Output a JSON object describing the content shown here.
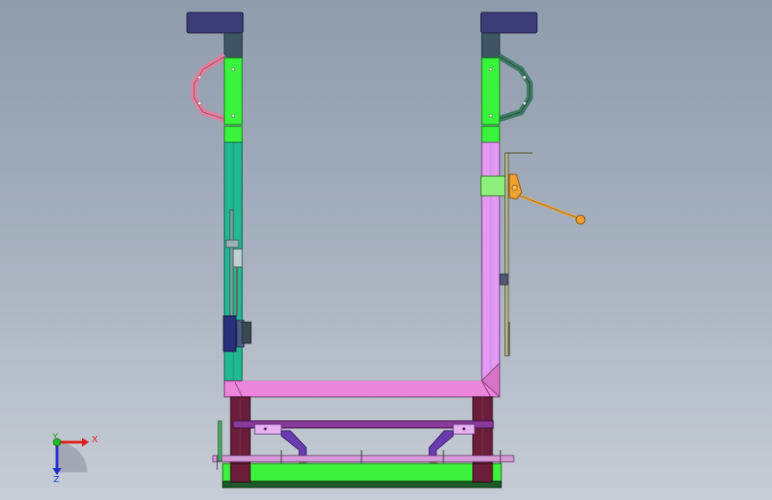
{
  "colors": {
    "background_top": "#8f9cac",
    "background_bottom": "#c7cdd6",
    "cap_navy": "#3b3d78",
    "column_slate": "#3e5566",
    "bracket_green": "#38f43a",
    "left_column_teal": "#22b892",
    "right_column_violet": "#e39af2",
    "base_pink": "#ec86dc",
    "left_handle_pink": "#e37f9f",
    "right_handle_green": "#3f7a64",
    "lever_orange": "#f0a030",
    "leg_maroon": "#6a1e3a",
    "rail_purple": "#8a3a9a",
    "foot_green": "#3ef23c",
    "axis_x_red": "#e02020",
    "axis_y_green": "#20c020",
    "axis_z_blue": "#2030d0"
  },
  "triad": {
    "x_label": "X",
    "y_label": "Y",
    "z_label": "Z"
  }
}
